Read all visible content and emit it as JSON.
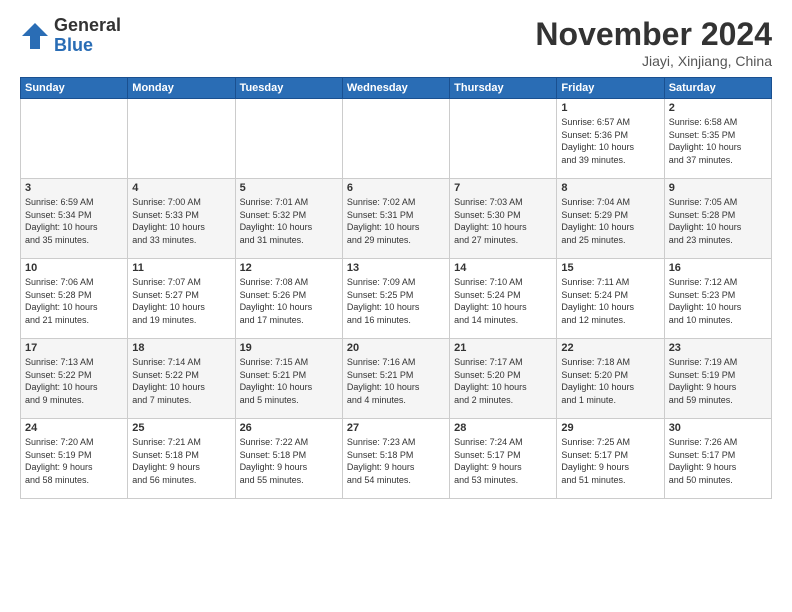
{
  "logo": {
    "general": "General",
    "blue": "Blue"
  },
  "header": {
    "month_title": "November 2024",
    "location": "Jiayi, Xinjiang, China"
  },
  "days_of_week": [
    "Sunday",
    "Monday",
    "Tuesday",
    "Wednesday",
    "Thursday",
    "Friday",
    "Saturday"
  ],
  "weeks": [
    [
      {
        "day": "",
        "info": ""
      },
      {
        "day": "",
        "info": ""
      },
      {
        "day": "",
        "info": ""
      },
      {
        "day": "",
        "info": ""
      },
      {
        "day": "",
        "info": ""
      },
      {
        "day": "1",
        "info": "Sunrise: 6:57 AM\nSunset: 5:36 PM\nDaylight: 10 hours\nand 39 minutes."
      },
      {
        "day": "2",
        "info": "Sunrise: 6:58 AM\nSunset: 5:35 PM\nDaylight: 10 hours\nand 37 minutes."
      }
    ],
    [
      {
        "day": "3",
        "info": "Sunrise: 6:59 AM\nSunset: 5:34 PM\nDaylight: 10 hours\nand 35 minutes."
      },
      {
        "day": "4",
        "info": "Sunrise: 7:00 AM\nSunset: 5:33 PM\nDaylight: 10 hours\nand 33 minutes."
      },
      {
        "day": "5",
        "info": "Sunrise: 7:01 AM\nSunset: 5:32 PM\nDaylight: 10 hours\nand 31 minutes."
      },
      {
        "day": "6",
        "info": "Sunrise: 7:02 AM\nSunset: 5:31 PM\nDaylight: 10 hours\nand 29 minutes."
      },
      {
        "day": "7",
        "info": "Sunrise: 7:03 AM\nSunset: 5:30 PM\nDaylight: 10 hours\nand 27 minutes."
      },
      {
        "day": "8",
        "info": "Sunrise: 7:04 AM\nSunset: 5:29 PM\nDaylight: 10 hours\nand 25 minutes."
      },
      {
        "day": "9",
        "info": "Sunrise: 7:05 AM\nSunset: 5:28 PM\nDaylight: 10 hours\nand 23 minutes."
      }
    ],
    [
      {
        "day": "10",
        "info": "Sunrise: 7:06 AM\nSunset: 5:28 PM\nDaylight: 10 hours\nand 21 minutes."
      },
      {
        "day": "11",
        "info": "Sunrise: 7:07 AM\nSunset: 5:27 PM\nDaylight: 10 hours\nand 19 minutes."
      },
      {
        "day": "12",
        "info": "Sunrise: 7:08 AM\nSunset: 5:26 PM\nDaylight: 10 hours\nand 17 minutes."
      },
      {
        "day": "13",
        "info": "Sunrise: 7:09 AM\nSunset: 5:25 PM\nDaylight: 10 hours\nand 16 minutes."
      },
      {
        "day": "14",
        "info": "Sunrise: 7:10 AM\nSunset: 5:24 PM\nDaylight: 10 hours\nand 14 minutes."
      },
      {
        "day": "15",
        "info": "Sunrise: 7:11 AM\nSunset: 5:24 PM\nDaylight: 10 hours\nand 12 minutes."
      },
      {
        "day": "16",
        "info": "Sunrise: 7:12 AM\nSunset: 5:23 PM\nDaylight: 10 hours\nand 10 minutes."
      }
    ],
    [
      {
        "day": "17",
        "info": "Sunrise: 7:13 AM\nSunset: 5:22 PM\nDaylight: 10 hours\nand 9 minutes."
      },
      {
        "day": "18",
        "info": "Sunrise: 7:14 AM\nSunset: 5:22 PM\nDaylight: 10 hours\nand 7 minutes."
      },
      {
        "day": "19",
        "info": "Sunrise: 7:15 AM\nSunset: 5:21 PM\nDaylight: 10 hours\nand 5 minutes."
      },
      {
        "day": "20",
        "info": "Sunrise: 7:16 AM\nSunset: 5:21 PM\nDaylight: 10 hours\nand 4 minutes."
      },
      {
        "day": "21",
        "info": "Sunrise: 7:17 AM\nSunset: 5:20 PM\nDaylight: 10 hours\nand 2 minutes."
      },
      {
        "day": "22",
        "info": "Sunrise: 7:18 AM\nSunset: 5:20 PM\nDaylight: 10 hours\nand 1 minute."
      },
      {
        "day": "23",
        "info": "Sunrise: 7:19 AM\nSunset: 5:19 PM\nDaylight: 9 hours\nand 59 minutes."
      }
    ],
    [
      {
        "day": "24",
        "info": "Sunrise: 7:20 AM\nSunset: 5:19 PM\nDaylight: 9 hours\nand 58 minutes."
      },
      {
        "day": "25",
        "info": "Sunrise: 7:21 AM\nSunset: 5:18 PM\nDaylight: 9 hours\nand 56 minutes."
      },
      {
        "day": "26",
        "info": "Sunrise: 7:22 AM\nSunset: 5:18 PM\nDaylight: 9 hours\nand 55 minutes."
      },
      {
        "day": "27",
        "info": "Sunrise: 7:23 AM\nSunset: 5:18 PM\nDaylight: 9 hours\nand 54 minutes."
      },
      {
        "day": "28",
        "info": "Sunrise: 7:24 AM\nSunset: 5:17 PM\nDaylight: 9 hours\nand 53 minutes."
      },
      {
        "day": "29",
        "info": "Sunrise: 7:25 AM\nSunset: 5:17 PM\nDaylight: 9 hours\nand 51 minutes."
      },
      {
        "day": "30",
        "info": "Sunrise: 7:26 AM\nSunset: 5:17 PM\nDaylight: 9 hours\nand 50 minutes."
      }
    ]
  ]
}
